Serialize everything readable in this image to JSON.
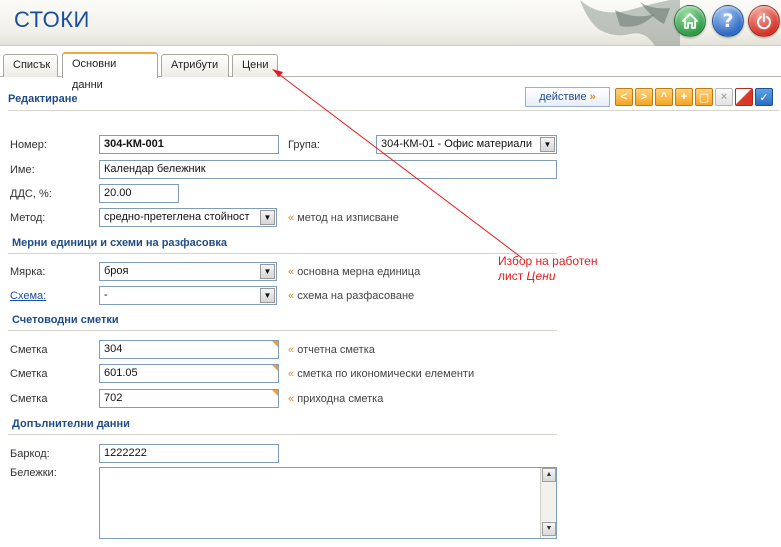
{
  "app": {
    "title": "СТОКИ"
  },
  "header": {
    "help_glyph": "?"
  },
  "tabs": [
    {
      "label": "Списък",
      "active": false
    },
    {
      "label": "Основни данни",
      "active": true
    },
    {
      "label": "Атрибути",
      "active": false
    },
    {
      "label": "Цени",
      "active": false
    }
  ],
  "edit": {
    "title": "Редактиране",
    "action_label": "действие",
    "action_arrow": "»",
    "toolbar_icons": [
      "first-icon",
      "prev-icon",
      "next-icon",
      "up-icon",
      "add-icon",
      "copy-icon",
      "delete-icon",
      "cancel-icon",
      "save-check-icon"
    ],
    "toolbar_glyphs": {
      "first": "<",
      "prev": "<",
      "next": ">",
      "up": "^",
      "add": "+",
      "copy": "▢",
      "delete": "×",
      "save": "✓"
    }
  },
  "form": {
    "number_label": "Номер:",
    "number_value": "304-КМ-001",
    "group_label": "Група:",
    "group_value": "304-КМ-01 - Офис материали",
    "name_label": "Име:",
    "name_value": "Календар бележник",
    "vat_label": "ДДС, %:",
    "vat_value": "20.00",
    "method_label": "Метод:",
    "method_value": "средно-претеглена стойност",
    "method_hint": "метод на изписване"
  },
  "units": {
    "title": "Мерни единици и схеми на разфасовка",
    "brand_label": "Мярка:",
    "brand_value": "броя",
    "brand_hint": "основна мерна единица",
    "scheme_label": "Схема:",
    "scheme_value": "-",
    "scheme_hint": "схема на разфасоване"
  },
  "accounts": {
    "title": "Счетоводни сметки",
    "rows": [
      {
        "label": "Сметка",
        "value": "304",
        "hint": "отчетна сметка"
      },
      {
        "label": "Сметка",
        "value": "601.05",
        "hint": "сметка по икономически елементи"
      },
      {
        "label": "Сметка",
        "value": "702",
        "hint": "приходна сметка"
      }
    ]
  },
  "extra": {
    "title": "Допълнителни данни",
    "barcode_label": "Баркод:",
    "barcode_value": "1222222",
    "notes_label": "Бележки:",
    "notes_value": ""
  },
  "hint_marker": "«",
  "dropdown_glyph": "▼",
  "scroll_glyphs": {
    "up": "▲",
    "down": "▼"
  },
  "annotation": {
    "line1": "Избор на работен",
    "line2_prefix": "лист ",
    "line2_italic": "Цени",
    "color": "#e61c1c"
  },
  "colors": {
    "title_blue": "#1a4f9c",
    "section_blue": "#1f4c86",
    "accent_orange": "#f2a73d"
  }
}
